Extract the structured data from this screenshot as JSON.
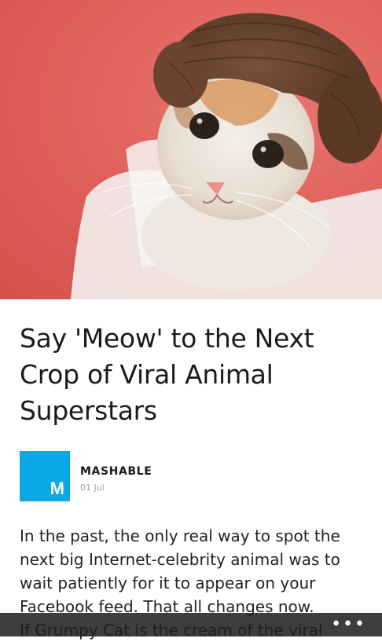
{
  "article": {
    "title_lines": [
      "Say 'Meow' to the Next",
      "Crop of Viral Animal",
      "Superstars"
    ],
    "source": {
      "logo_letter": "M",
      "name": "MASHABLE",
      "date": "01 Jul"
    },
    "body_lines": [
      "In the past, the only real way to spot the",
      "next big Internet-celebrity animal was to",
      "wait patiently for it to appear on your",
      "Facebook feed. That all changes now.",
      "If Grumpy Cat is the cream of the viral"
    ]
  },
  "app_bar": {
    "more_label": "•••"
  },
  "colors": {
    "accent_logo": "#0aa9e6",
    "hero_background": "#df5f59",
    "app_bar": "#1e1e1e"
  },
  "icons": {
    "more": "ellipsis-icon"
  }
}
